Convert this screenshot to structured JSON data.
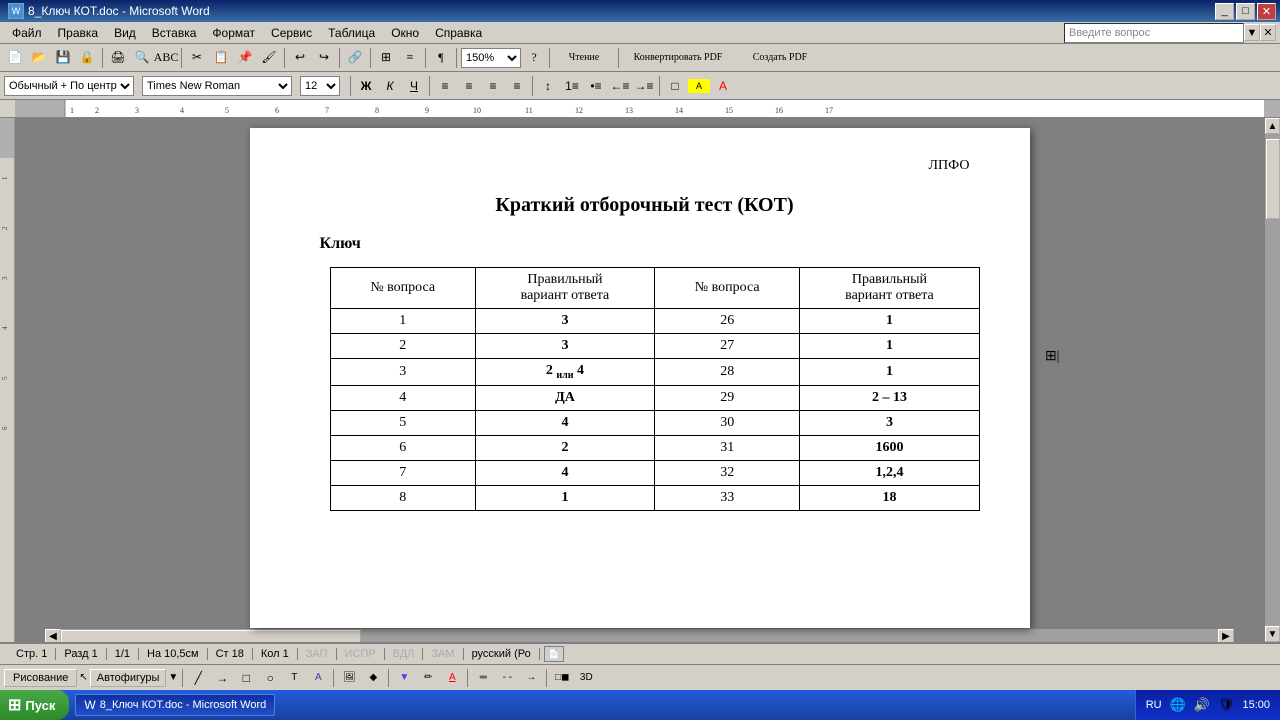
{
  "window": {
    "title": "8_Ключ КОТ.doc - Microsoft Word",
    "icon": "W"
  },
  "menubar": {
    "items": [
      "Файл",
      "Правка",
      "Вид",
      "Вставка",
      "Формат",
      "Сервис",
      "Таблица",
      "Окно",
      "Справка"
    ]
  },
  "toolbar": {
    "zoom": "150%",
    "mode_btn": "Чтение",
    "pdf_btn1": "Конвертировать PDF",
    "pdf_btn2": "Создать PDF"
  },
  "formatting": {
    "style": "Обычный + По центру",
    "font": "Times New Roman",
    "size": "12",
    "bold": "Ж",
    "italic": "К",
    "underline": "Ч"
  },
  "help_box": {
    "placeholder": "Введите вопрос"
  },
  "document": {
    "header_right": "ЛПФО",
    "title": "Краткий отборочный тест (КОТ)",
    "subtitle": "Ключ",
    "table": {
      "headers": [
        "№ вопроса",
        "Правильный вариант ответа",
        "№ вопроса",
        "Правильный вариант ответа"
      ],
      "rows": [
        {
          "q1": "1",
          "a1": "3",
          "q2": "26",
          "a2": "1"
        },
        {
          "q1": "2",
          "a1": "3",
          "q2": "27",
          "a2": "1"
        },
        {
          "q1": "3",
          "a1": "2 или 4",
          "q2": "28",
          "a2": "1"
        },
        {
          "q1": "4",
          "a1": "ДА",
          "q2": "29",
          "a2": "2 – 13"
        },
        {
          "q1": "5",
          "a1": "4",
          "q2": "30",
          "a2": "3"
        },
        {
          "q1": "6",
          "a1": "2",
          "q2": "31",
          "a2": "1600"
        },
        {
          "q1": "7",
          "a1": "4",
          "q2": "32",
          "a2": "1,2,4"
        },
        {
          "q1": "8",
          "a1": "1",
          "q2": "33",
          "a2": "18"
        }
      ]
    }
  },
  "statusbar": {
    "page": "Стр. 1",
    "section": "Разд 1",
    "pages": "1/1",
    "position": "На 10,5см",
    "line": "Ст 18",
    "col": "Кол 1",
    "zap": "ЗАП",
    "ispr": "ИСПР",
    "vdl": "ВДЛ",
    "zam": "ЗАМ",
    "lang": "русский (Ро"
  },
  "taskbar": {
    "time": "15:00",
    "lang": "RU",
    "app": "8_Ключ КОТ.doc - Microsoft Word",
    "start": "Пуск"
  },
  "drawing_toolbar": {
    "draw_btn": "Рисование",
    "autoshapes_btn": "Автофигуры"
  }
}
